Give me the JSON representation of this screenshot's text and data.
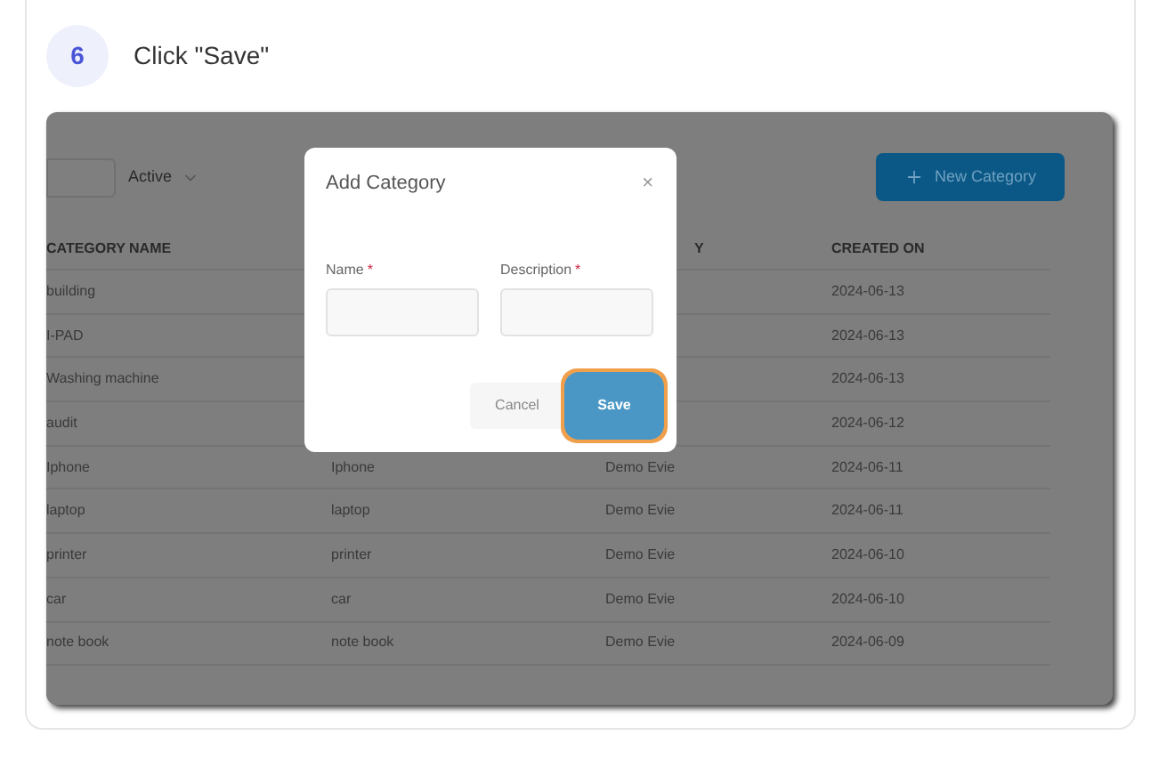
{
  "step": {
    "number": "6",
    "instruction": "Click \"Save\""
  },
  "toolbar": {
    "status_filter": "Active",
    "new_button": "New Category"
  },
  "table": {
    "columns": [
      "CATEGORY NAME",
      "Y",
      "CREATED ON"
    ],
    "rows": [
      {
        "category_name": "building",
        "created_on": "2024-06-13"
      },
      {
        "category_name": "I-PAD",
        "created_on": "2024-06-13"
      },
      {
        "category_name": "Washing machine",
        "created_on": "2024-06-13"
      },
      {
        "category_name": "audit",
        "created_on": "2024-06-12"
      },
      {
        "category_name": "Iphone",
        "description": "Iphone",
        "created_by": "Demo Evie",
        "created_on": "2024-06-11"
      },
      {
        "category_name": "laptop",
        "description": "laptop",
        "created_by": "Demo Evie",
        "created_on": "2024-06-11"
      },
      {
        "category_name": "printer",
        "description": "printer",
        "created_by": "Demo Evie",
        "created_on": "2024-06-10"
      },
      {
        "category_name": "car",
        "description": "car",
        "created_by": "Demo Evie",
        "created_on": "2024-06-10"
      },
      {
        "category_name": "note book",
        "description": "note book",
        "created_by": "Demo Evie",
        "created_on": "2024-06-09"
      }
    ]
  },
  "dialog": {
    "title": "Add Category",
    "close": "×",
    "fields": [
      {
        "label": "Name",
        "required_mark": "*"
      },
      {
        "label": "Description",
        "required_mark": "*"
      }
    ],
    "cancel": "Cancel",
    "save": "Save",
    "save_highlighted": true
  }
}
